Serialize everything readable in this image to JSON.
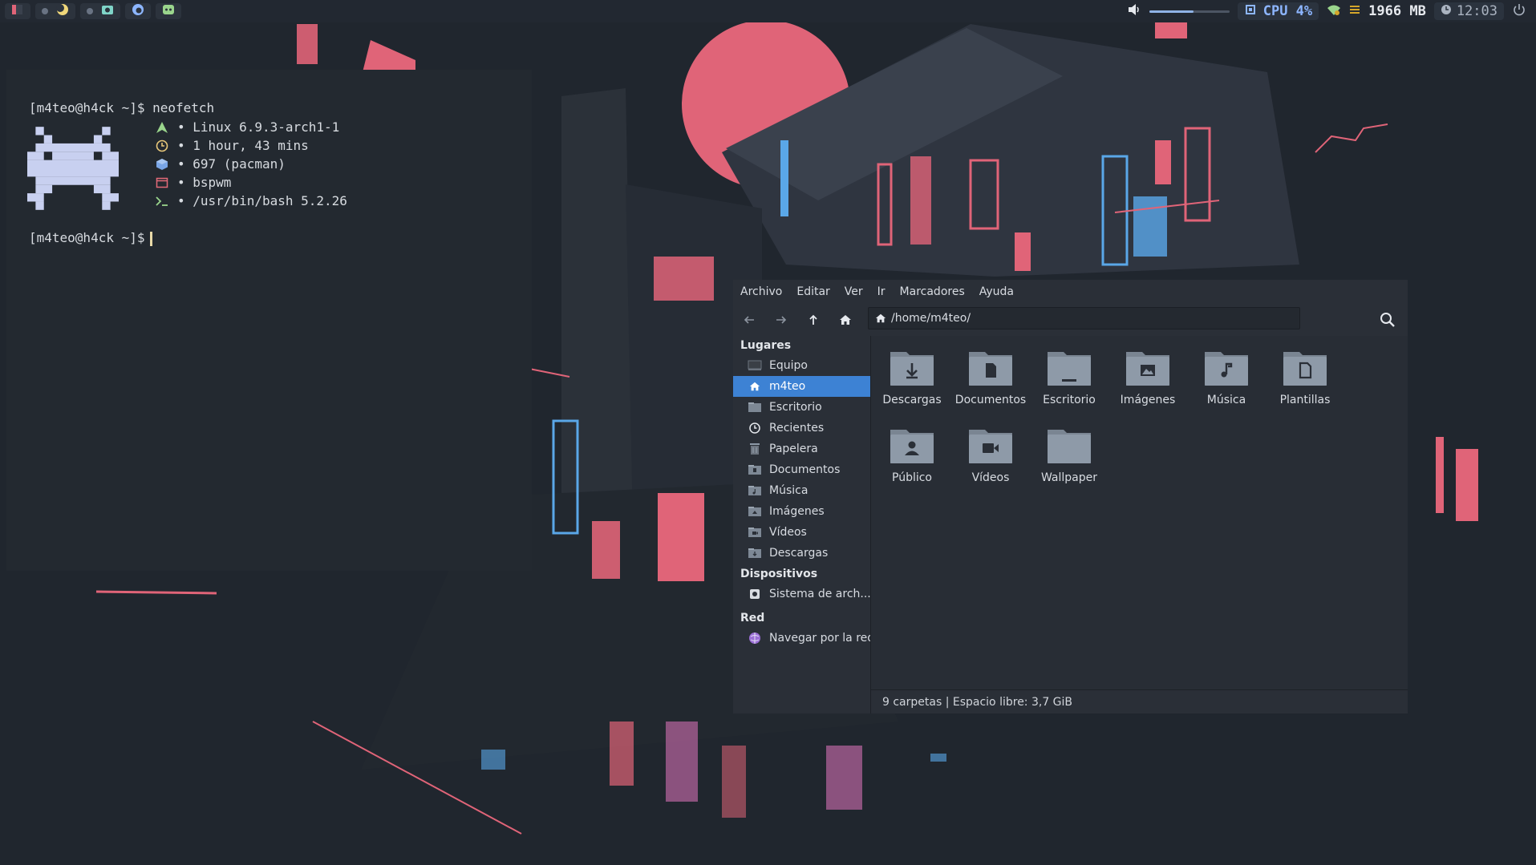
{
  "topbar": {
    "cpu_label": "CPU 4%",
    "memory": "1966 MB",
    "clock": "12:03",
    "volume_level": 0.55,
    "colors": {
      "accent": "#8db6ff",
      "battery": "#d4a62a"
    }
  },
  "terminal": {
    "prompt1": "[m4teo@h4ck ~]$ neofetch",
    "info": [
      {
        "icon": "arch-logo-icon",
        "color": "#9ad58c",
        "text": "• Linux 6.9.3-arch1-1"
      },
      {
        "icon": "clock-icon",
        "color": "#e9c87a",
        "text": "• 1 hour, 43 mins"
      },
      {
        "icon": "package-icon",
        "color": "#7aa6e6",
        "text": "• 697 (pacman)"
      },
      {
        "icon": "window-icon",
        "color": "#e46a78",
        "text": "• bspwm"
      },
      {
        "icon": "terminal-prompt-icon",
        "color": "#9ad58c",
        "text": "• /usr/bin/bash 5.2.26"
      }
    ],
    "prompt2": "[m4teo@h4ck ~]$"
  },
  "file_manager": {
    "menu": [
      "Archivo",
      "Editar",
      "Ver",
      "Ir",
      "Marcadores",
      "Ayuda"
    ],
    "path": "/home/m4teo/",
    "sidebar": {
      "places_title": "Lugares",
      "places": [
        {
          "label": "Equipo",
          "icon": "computer-icon",
          "active": false
        },
        {
          "label": "m4teo",
          "icon": "home-icon",
          "active": true
        },
        {
          "label": "Escritorio",
          "icon": "desktop-folder-icon",
          "active": false
        },
        {
          "label": "Recientes",
          "icon": "recent-icon",
          "active": false
        },
        {
          "label": "Papelera",
          "icon": "trash-icon",
          "active": false
        },
        {
          "label": "Documentos",
          "icon": "documents-folder-icon",
          "active": false
        },
        {
          "label": "Música",
          "icon": "music-folder-icon",
          "active": false
        },
        {
          "label": "Imágenes",
          "icon": "pictures-folder-icon",
          "active": false
        },
        {
          "label": "Vídeos",
          "icon": "videos-folder-icon",
          "active": false
        },
        {
          "label": "Descargas",
          "icon": "downloads-folder-icon",
          "active": false
        }
      ],
      "devices_title": "Dispositivos",
      "devices": [
        {
          "label": "Sistema de arch...",
          "icon": "drive-icon"
        }
      ],
      "network_title": "Red",
      "network": [
        {
          "label": "Navegar por la red",
          "icon": "network-icon"
        }
      ]
    },
    "folders": [
      {
        "label": "Descargas",
        "glyph": "download"
      },
      {
        "label": "Documentos",
        "glyph": "document"
      },
      {
        "label": "Escritorio",
        "glyph": "desktop"
      },
      {
        "label": "Imágenes",
        "glyph": "picture"
      },
      {
        "label": "Música",
        "glyph": "music"
      },
      {
        "label": "Plantillas",
        "glyph": "template"
      },
      {
        "label": "Público",
        "glyph": "user"
      },
      {
        "label": "Vídeos",
        "glyph": "video"
      },
      {
        "label": "Wallpaper",
        "glyph": "none"
      }
    ],
    "status": "9 carpetas  |  Espacio libre: 3,7 GiB",
    "colors": {
      "selection": "#3d82d4",
      "folder": "#8e9aa8"
    }
  }
}
